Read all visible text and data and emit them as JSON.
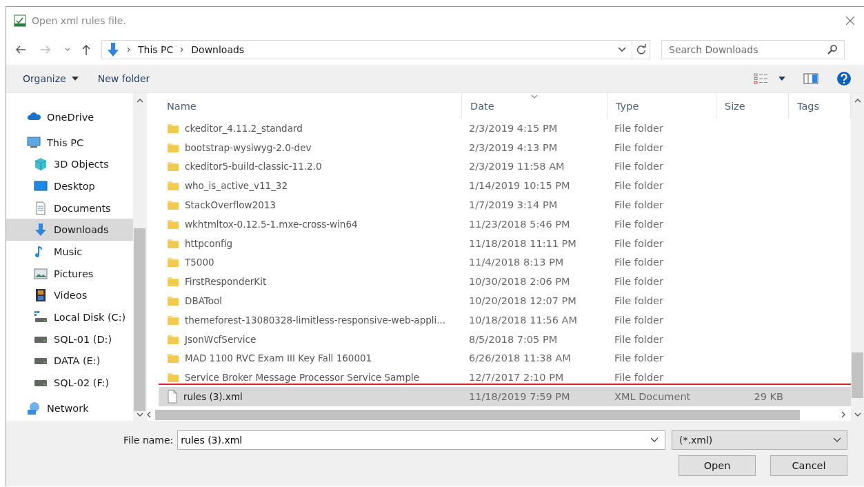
{
  "window": {
    "title": "Open xml rules file."
  },
  "address": {
    "path": [
      "This PC",
      "Downloads"
    ]
  },
  "search": {
    "placeholder": "Search Downloads"
  },
  "toolbar": {
    "organize": "Organize",
    "new_folder": "New folder"
  },
  "sidebar": {
    "items": [
      {
        "label": "OneDrive",
        "kind": "cloud",
        "selected": false
      },
      {
        "label": "This PC",
        "kind": "pc",
        "selected": false,
        "children": [
          {
            "label": "3D Objects",
            "kind": "cube",
            "selected": false
          },
          {
            "label": "Desktop",
            "kind": "desktop",
            "selected": false
          },
          {
            "label": "Documents",
            "kind": "document",
            "selected": false
          },
          {
            "label": "Downloads",
            "kind": "download",
            "selected": true
          },
          {
            "label": "Music",
            "kind": "music",
            "selected": false
          },
          {
            "label": "Pictures",
            "kind": "pictures",
            "selected": false
          },
          {
            "label": "Videos",
            "kind": "videos",
            "selected": false
          },
          {
            "label": "Local Disk (C:)",
            "kind": "system-drive",
            "selected": false
          },
          {
            "label": "SQL-01 (D:)",
            "kind": "drive",
            "selected": false
          },
          {
            "label": "DATA (E:)",
            "kind": "drive",
            "selected": false
          },
          {
            "label": "SQL-02 (F:)",
            "kind": "drive",
            "selected": false
          }
        ]
      },
      {
        "label": "Network",
        "kind": "network",
        "selected": false
      }
    ]
  },
  "table": {
    "columns": [
      {
        "label": "Name",
        "sorted": false
      },
      {
        "label": "Date",
        "sorted": true
      },
      {
        "label": "Type",
        "sorted": false
      },
      {
        "label": "Size",
        "sorted": false
      },
      {
        "label": "Tags",
        "sorted": false
      }
    ],
    "rows": [
      {
        "kind": "folder",
        "name": "ckeditor_4.11.2_standard",
        "date": "2/3/2019 4:15 PM",
        "type": "File folder",
        "selected": false,
        "highlighted": false
      },
      {
        "kind": "folder",
        "name": "bootstrap-wysiwyg-2.0-dev",
        "date": "2/3/2019 4:13 PM",
        "type": "File folder",
        "selected": false,
        "highlighted": false
      },
      {
        "kind": "folder",
        "name": "ckeditor5-build-classic-11.2.0",
        "date": "2/3/2019 11:58 AM",
        "type": "File folder",
        "selected": false,
        "highlighted": false
      },
      {
        "kind": "folder",
        "name": "who_is_active_v11_32",
        "date": "1/14/2019 10:15 PM",
        "type": "File folder",
        "selected": false,
        "highlighted": false
      },
      {
        "kind": "folder",
        "name": "StackOverflow2013",
        "date": "1/7/2019 3:14 PM",
        "type": "File folder",
        "selected": false,
        "highlighted": false
      },
      {
        "kind": "folder",
        "name": "wkhtmltox-0.12.5-1.mxe-cross-win64",
        "date": "11/23/2018 5:46 PM",
        "type": "File folder",
        "selected": false,
        "highlighted": false
      },
      {
        "kind": "folder",
        "name": "httpconfig",
        "date": "11/18/2018 11:11 PM",
        "type": "File folder",
        "selected": false,
        "highlighted": false
      },
      {
        "kind": "folder",
        "name": "T5000",
        "date": "11/4/2018 8:13 PM",
        "type": "File folder",
        "selected": false,
        "highlighted": false
      },
      {
        "kind": "folder",
        "name": "FirstResponderKit",
        "date": "10/30/2018 2:06 PM",
        "type": "File folder",
        "selected": false,
        "highlighted": false
      },
      {
        "kind": "folder",
        "name": "DBATool",
        "date": "10/20/2018 12:07 PM",
        "type": "File folder",
        "selected": false,
        "highlighted": false
      },
      {
        "kind": "folder",
        "name": "themeforest-13080328-limitless-responsive-web-appli...",
        "date": "10/18/2018 11:56 AM",
        "type": "File folder",
        "selected": false,
        "highlighted": false
      },
      {
        "kind": "folder",
        "name": "JsonWcfService",
        "date": "8/5/2018 7:05 PM",
        "type": "File folder",
        "selected": false,
        "highlighted": false
      },
      {
        "kind": "folder",
        "name": "MAD 1100 RVC Exam III Key Fall 160001",
        "date": "6/26/2018 11:38 AM",
        "type": "File folder",
        "selected": false,
        "highlighted": false
      },
      {
        "kind": "folder",
        "name": "Service Broker Message Processor Service Sample",
        "date": "12/7/2017 2:10 PM",
        "type": "File folder",
        "selected": false,
        "highlighted": false
      },
      {
        "kind": "file",
        "name": "rules (3).xml",
        "date": "11/18/2019 7:59 PM",
        "type": "XML Document",
        "size": "29 KB",
        "selected": true,
        "highlighted": true
      }
    ]
  },
  "file_name": {
    "label": "File name:",
    "value": "rules (3).xml"
  },
  "filter": {
    "value": "(*.xml)"
  },
  "buttons": [
    "Open",
    "Cancel"
  ]
}
